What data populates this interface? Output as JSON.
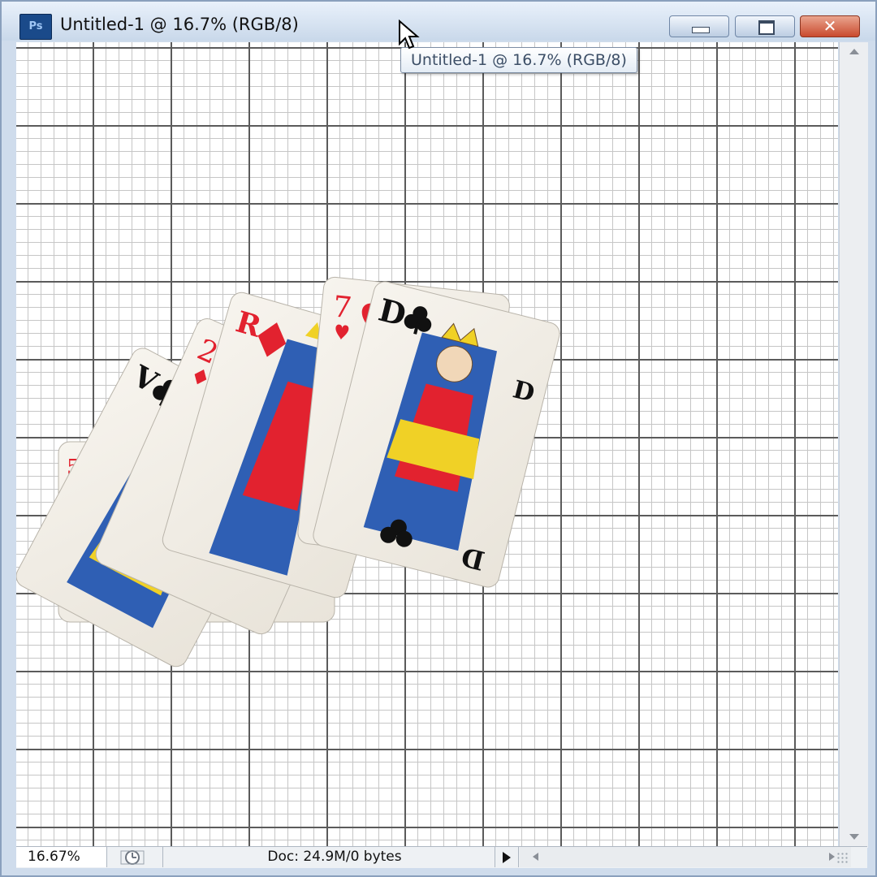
{
  "window": {
    "app_icon": "photoshop-icon",
    "app_icon_text": "Ps",
    "title": "Untitled-1 @ 16.7% (RGB/8)",
    "close_glyph": "✕"
  },
  "tooltip": {
    "text": "Untitled-1 @ 16.7% (RGB/8)"
  },
  "canvas": {
    "content": "fan of playing cards",
    "cards": [
      {
        "rank": "5",
        "suit": "diamonds"
      },
      {
        "rank": "V",
        "suit": "clubs"
      },
      {
        "rank": "2",
        "suit": "diamonds"
      },
      {
        "rank": "R",
        "suit": "diamonds"
      },
      {
        "rank": "7",
        "suit": "hearts"
      },
      {
        "rank": "D",
        "suit": "clubs"
      }
    ]
  },
  "status": {
    "zoom": "16.67%",
    "doc_info": "Doc: 24.9M/0 bytes"
  },
  "colors": {
    "red_suit": "#e2222f",
    "black_suit": "#111111",
    "titlebar": "#d5e2f1"
  }
}
